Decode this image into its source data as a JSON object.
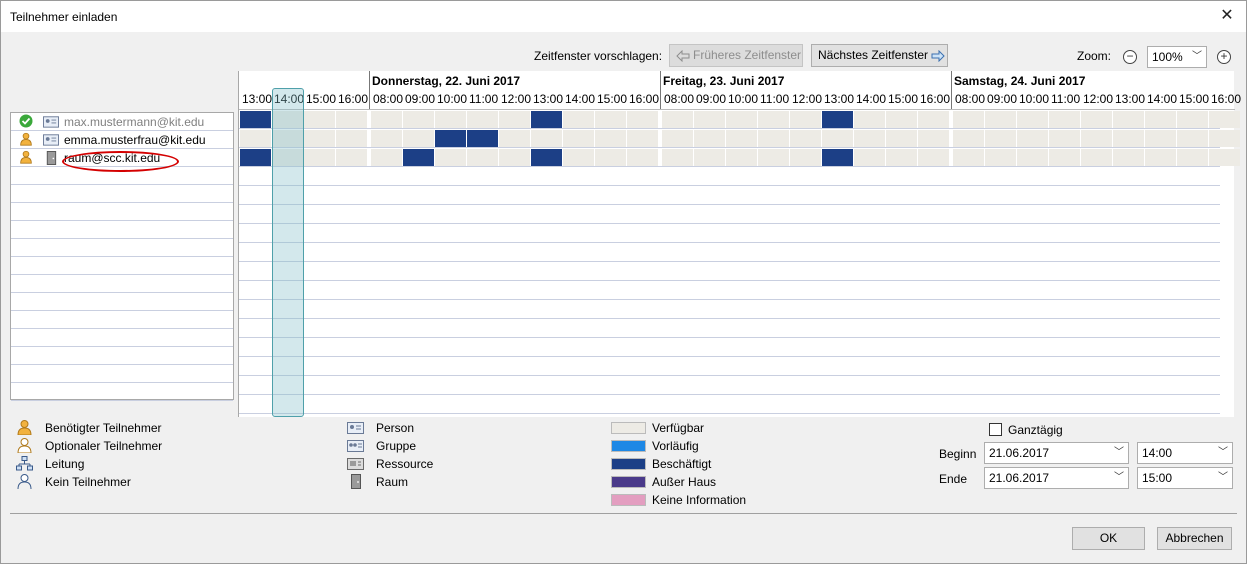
{
  "window": {
    "title": "Teilnehmer einladen"
  },
  "toolbar": {
    "suggest_label": "Zeitfenster vorschlagen:",
    "earlier_label": "Früheres Zeitfenster",
    "next_label": "Nächstes Zeitfenster",
    "zoom_label": "Zoom:",
    "zoom_value": "100%"
  },
  "attendees": [
    {
      "email": "max.mustermann@kit.edu",
      "role": "accepted",
      "type": "person"
    },
    {
      "email": "emma.musterfrau@kit.edu",
      "role": "required",
      "type": "person"
    },
    {
      "email": "raum@scc.kit.edu",
      "role": "required",
      "type": "room"
    }
  ],
  "grid": {
    "days": [
      {
        "label": "",
        "hours": [
          "13:00",
          "14:00",
          "15:00",
          "16:00"
        ]
      },
      {
        "label": "Donnerstag, 22. Juni 2017",
        "hours": [
          "08:00",
          "09:00",
          "10:00",
          "11:00",
          "12:00",
          "13:00",
          "14:00",
          "15:00",
          "16:00"
        ]
      },
      {
        "label": "Freitag, 23. Juni 2017",
        "hours": [
          "08:00",
          "09:00",
          "10:00",
          "11:00",
          "12:00",
          "13:00",
          "14:00",
          "15:00",
          "16:00"
        ]
      },
      {
        "label": "Samstag, 24. Juni 2017",
        "hours": [
          "08:00",
          "09:00",
          "10:00",
          "11:00",
          "12:00",
          "13:00",
          "14:00",
          "15:00",
          "16:00"
        ]
      }
    ],
    "busy": [
      {
        "row": 0,
        "slots": [
          0,
          9,
          18
        ]
      },
      {
        "row": 1,
        "slots": [
          6,
          7
        ]
      },
      {
        "row": 2,
        "slots": [
          0,
          5,
          9,
          18
        ]
      }
    ]
  },
  "legend": {
    "roles": [
      "Benötigter Teilnehmer",
      "Optionaler Teilnehmer",
      "Leitung",
      "Kein Teilnehmer"
    ],
    "types": [
      "Person",
      "Gruppe",
      "Ressource",
      "Raum"
    ],
    "status": [
      {
        "label": "Verfügbar",
        "color": "#edebe5"
      },
      {
        "label": "Vorläufig",
        "color": "#1e88e5"
      },
      {
        "label": "Beschäftigt",
        "color": "#1c3f86"
      },
      {
        "label": "Außer Haus",
        "color": "#4a3a8a"
      },
      {
        "label": "Keine Information",
        "color": "#e39ec0"
      }
    ]
  },
  "datetime": {
    "allday_label": "Ganztägig",
    "begin_label": "Beginn",
    "end_label": "Ende",
    "begin_date": "21.06.2017",
    "begin_time": "14:00",
    "end_date": "21.06.2017",
    "end_time": "15:00"
  },
  "buttons": {
    "ok": "OK",
    "cancel": "Abbrechen"
  }
}
